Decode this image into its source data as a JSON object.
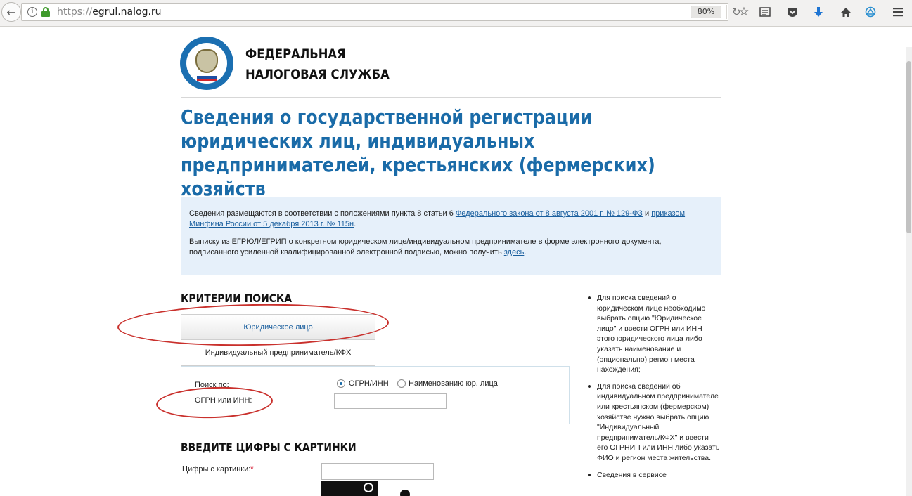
{
  "browser": {
    "url_protocol": "https://",
    "url_host": "egrul.nalog.ru",
    "zoom": "80%",
    "reload_icon": "reload-icon",
    "toolbar_icons": [
      "bookmark-star-icon",
      "reading-list-icon",
      "pocket-icon",
      "downloads-icon",
      "home-icon",
      "sync-icon",
      "menu-icon"
    ]
  },
  "header": {
    "org_line1": "ФЕДЕРАЛЬНАЯ",
    "org_line2": "НАЛОГОВАЯ СЛУЖБА"
  },
  "page_title": "Сведения о государственной регистрации юридических лиц, индивидуальных предпринимателей, крестьянских (фермерских) хозяйств",
  "info": {
    "p1_text": "Сведения размещаются в соответствии с положениями пункта 8 статьи 6 ",
    "p1_link1": "Федерального закона от 8 августа 2001 г. № 129-ФЗ",
    "p1_mid": " и ",
    "p1_link2": "приказом Минфина России от 5 декабря 2013 г. № 115н",
    "p1_end": ".",
    "p2_text": "Выписку из ЕГРЮЛ/ЕГРИП о конкретном юридическом лице/индивидуальном предпринимателе в форме электронного документа, подписанного усиленной квалифицированной электронной подписью, можно получить ",
    "p2_link": "здесь",
    "p2_end": "."
  },
  "search": {
    "heading": "КРИТЕРИИ ПОИСКА",
    "tab_legal": "Юридическое лицо",
    "tab_ip": "Индивидуальный предприниматель/КФХ",
    "search_by_label": "Поиск по:",
    "radio_ogrn": "ОГРН/ИНН",
    "radio_name": "Наименованию юр. лица",
    "ogrn_label": "ОГРН или ИНН:",
    "ogrn_value": ""
  },
  "captcha": {
    "heading": "ВВЕДИТЕ ЦИФРЫ С КАРТИНКИ",
    "label": "Цифры с картинки:",
    "required_mark": "*",
    "value": ""
  },
  "help": {
    "items": [
      "Для поиска сведений о юридическом лице необходимо выбрать опцию \"Юридическое лицо\" и ввести ОГРН или ИНН этого юридического лица либо указать наименование и (опционально) регион места нахождения;",
      "Для поиска сведений об индивидуальном предпринимателе или крестьянском (фермерском) хозяйстве нужно выбрать опцию \"Индивидуальный предприниматель/КФХ\" и ввести его ОГРНИП или ИНН либо указать ФИО и регион места жительства.",
      "Сведения в сервисе"
    ]
  },
  "colors": {
    "accent": "#1a6ba8",
    "info_bg": "#e6f0fa",
    "annotation_red": "#c9302c"
  }
}
